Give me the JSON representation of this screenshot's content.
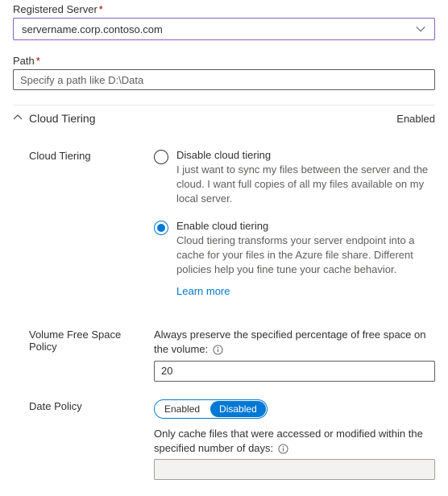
{
  "registered_server": {
    "label": "Registered Server",
    "required_mark": "*",
    "value": "servername.corp.contoso.com"
  },
  "path": {
    "label": "Path",
    "required_mark": "*",
    "placeholder": "Specify a path like D:\\Data",
    "value": ""
  },
  "cloud_tiering_section": {
    "title": "Cloud Tiering",
    "status": "Enabled"
  },
  "cloud_tiering": {
    "label": "Cloud Tiering",
    "options": {
      "disable": {
        "label": "Disable cloud tiering",
        "desc": "I just want to sync my files between the server and the cloud. I want full copies of all my files available on my local server."
      },
      "enable": {
        "label": "Enable cloud tiering",
        "desc": "Cloud tiering transforms your server endpoint into a cache for your files in the Azure file share. Different policies help you fine tune your cache behavior."
      }
    },
    "learn_more": "Learn more"
  },
  "volume_policy": {
    "label": "Volume Free Space Policy",
    "desc": "Always preserve the specified percentage of free space on the volume:",
    "value": "20"
  },
  "date_policy": {
    "label": "Date Policy",
    "toggle": {
      "enabled": "Enabled",
      "disabled": "Disabled"
    },
    "desc": "Only cache files that were accessed or modified within the specified number of days:",
    "value": ""
  }
}
